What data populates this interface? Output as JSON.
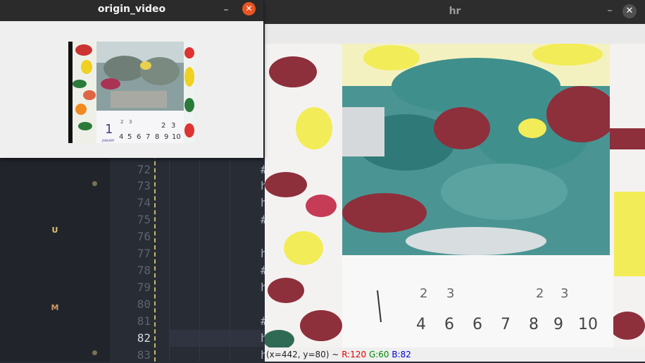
{
  "editor": {
    "gutter_marks": [
      {
        "label": "U",
        "kind": "u"
      },
      {
        "label": "M",
        "kind": "m"
      }
    ],
    "line_numbers": [
      "72",
      "73",
      "74",
      "75",
      "76",
      "77",
      "78",
      "79",
      "80",
      "81",
      "82",
      "83"
    ],
    "active_line": "82",
    "code_fragments": [
      "#",
      "h",
      "h",
      "#",
      "",
      "h",
      "#",
      "h",
      "",
      "#",
      "h",
      "h"
    ]
  },
  "hr_window": {
    "title": "hr",
    "minimize_label": "–",
    "close_label": "✕",
    "status": {
      "coords": "(x=442, y=80) ~",
      "r": "R:120",
      "g": "G:60",
      "b": "B:82"
    },
    "calendar_digits": [
      "1",
      "2",
      "3",
      "4",
      "5",
      "6",
      "7",
      "8",
      "9",
      "10"
    ]
  },
  "origin_window": {
    "title": "origin_video",
    "minimize_label": "–",
    "close_label": "✕",
    "calendar_big_digit": "1",
    "calendar_month": "JANUARY",
    "calendar_digits": [
      "2",
      "3",
      "4",
      "5",
      "6",
      "7",
      "8",
      "9",
      "10"
    ]
  },
  "colors": {
    "teal": "#3f8f8c",
    "maroon": "#8e2f3c",
    "yellow": "#f2ec58",
    "accent_close": "#e95420"
  }
}
